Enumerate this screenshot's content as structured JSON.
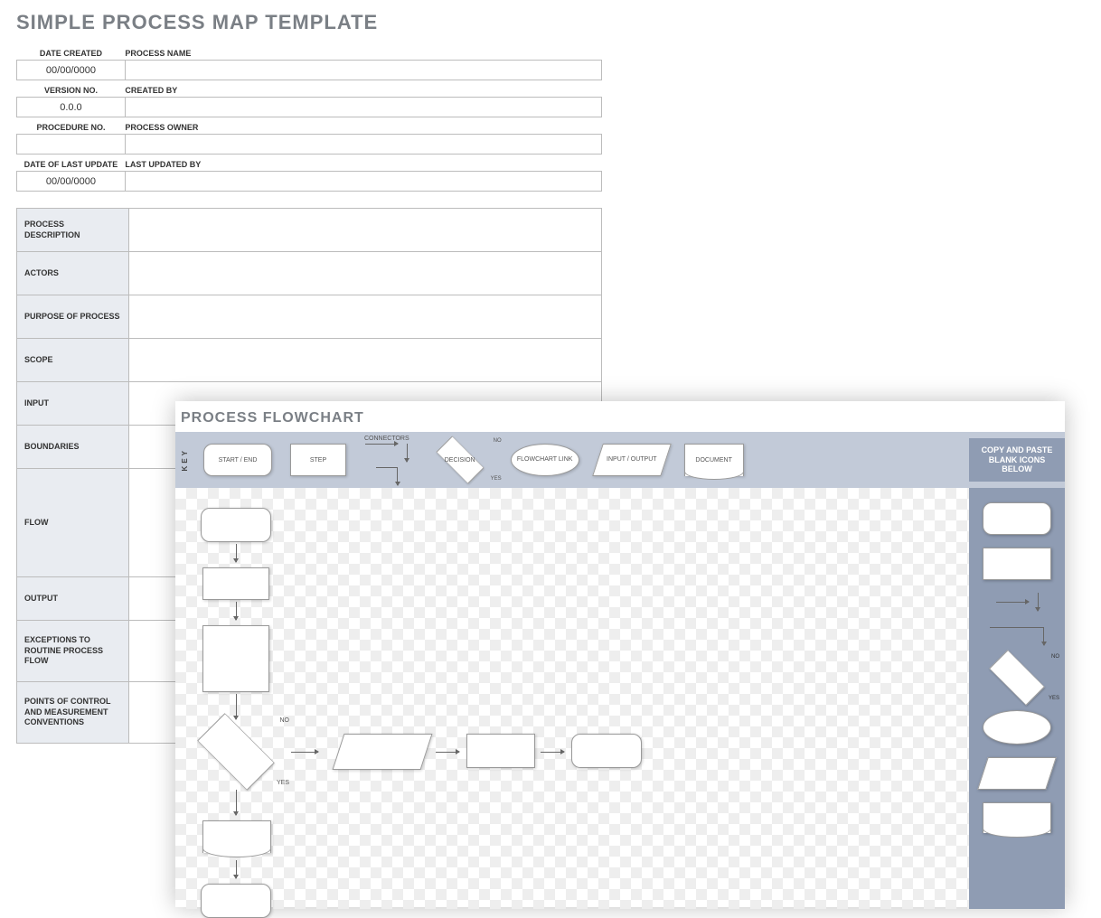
{
  "title": "SIMPLE PROCESS MAP TEMPLATE",
  "meta": {
    "date_created_label": "DATE CREATED",
    "date_created": "00/00/0000",
    "process_name_label": "PROCESS NAME",
    "process_name": "",
    "version_no_label": "VERSION NO.",
    "version_no": "0.0.0",
    "created_by_label": "CREATED BY",
    "created_by": "",
    "procedure_no_label": "PROCEDURE NO.",
    "procedure_no": "",
    "process_owner_label": "PROCESS OWNER",
    "process_owner": "",
    "date_last_update_label": "DATE OF LAST UPDATE",
    "date_last_update": "00/00/0000",
    "last_updated_by_label": "LAST UPDATED BY",
    "last_updated_by": ""
  },
  "desc": {
    "process_description_label": "PROCESS DESCRIPTION",
    "actors_label": "ACTORS",
    "purpose_label": "PURPOSE OF PROCESS",
    "scope_label": "SCOPE",
    "input_label": "INPUT",
    "boundaries_label": "BOUNDARIES",
    "flow_label": "FLOW",
    "output_label": "OUTPUT",
    "exceptions_label": "EXCEPTIONS TO ROUTINE PROCESS FLOW",
    "points_label": "POINTS OF CONTROL AND MEASUREMENT CONVENTIONS",
    "process_description": "",
    "actors": "",
    "purpose": "",
    "scope": "",
    "input": "",
    "boundaries": "",
    "flow": "",
    "output": "",
    "exceptions": "",
    "points": ""
  },
  "flowchart": {
    "title": "PROCESS FLOWCHART",
    "key_label": "KEY",
    "paste_label": "COPY AND PASTE BLANK ICONS BELOW",
    "key_items": {
      "start_end": "START / END",
      "step": "STEP",
      "connectors": "CONNECTORS",
      "decision": "DECISION",
      "no": "NO",
      "yes": "YES",
      "flowchart_link": "FLOWCHART LINK",
      "input_output": "INPUT / OUTPUT",
      "document": "DOCUMENT"
    }
  }
}
